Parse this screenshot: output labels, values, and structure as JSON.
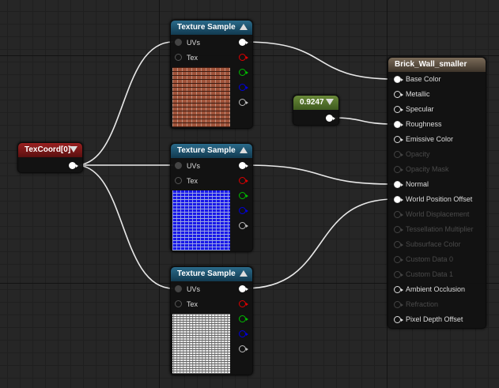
{
  "texcoord": {
    "title": "TexCoord[0]",
    "color": "#8a1a1a"
  },
  "constant": {
    "value": "0.9247",
    "color": "#5a7a30"
  },
  "texture_samples": [
    {
      "title": "Texture Sample",
      "inputs": [
        "UVs",
        "Tex"
      ],
      "preview": "brick-basecolor"
    },
    {
      "title": "Texture Sample",
      "inputs": [
        "UVs",
        "Tex"
      ],
      "preview": "brick-normal"
    },
    {
      "title": "Texture Sample",
      "inputs": [
        "UVs",
        "Tex"
      ],
      "preview": "brick-height"
    }
  ],
  "material": {
    "title": "Brick_Wall_smaller",
    "pins": [
      {
        "label": "Base Color",
        "enabled": true,
        "connected": true
      },
      {
        "label": "Metallic",
        "enabled": true,
        "connected": false
      },
      {
        "label": "Specular",
        "enabled": true,
        "connected": false
      },
      {
        "label": "Roughness",
        "enabled": true,
        "connected": true
      },
      {
        "label": "Emissive Color",
        "enabled": true,
        "connected": false
      },
      {
        "label": "Opacity",
        "enabled": false,
        "connected": false
      },
      {
        "label": "Opacity Mask",
        "enabled": false,
        "connected": false
      },
      {
        "label": "Normal",
        "enabled": true,
        "connected": true
      },
      {
        "label": "World Position Offset",
        "enabled": true,
        "connected": true
      },
      {
        "label": "World Displacement",
        "enabled": false,
        "connected": false
      },
      {
        "label": "Tessellation Multiplier",
        "enabled": false,
        "connected": false
      },
      {
        "label": "Subsurface Color",
        "enabled": false,
        "connected": false
      },
      {
        "label": "Custom Data 0",
        "enabled": false,
        "connected": false
      },
      {
        "label": "Custom Data 1",
        "enabled": false,
        "connected": false
      },
      {
        "label": "Ambient Occlusion",
        "enabled": true,
        "connected": false
      },
      {
        "label": "Refraction",
        "enabled": false,
        "connected": false
      },
      {
        "label": "Pixel Depth Offset",
        "enabled": true,
        "connected": false
      }
    ]
  }
}
